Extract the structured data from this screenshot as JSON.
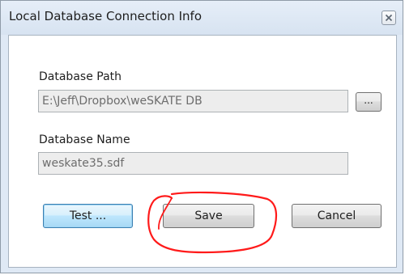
{
  "window": {
    "title": "Local Database Connection Info",
    "close_icon": "close-icon"
  },
  "form": {
    "path_label": "Database Path",
    "path_value": "E:\\Jeff\\Dropbox\\weSKATE DB",
    "browse_label": "...",
    "name_label": "Database Name",
    "name_value": "weskate35.sdf"
  },
  "buttons": {
    "test_label": "Test ...",
    "save_label": "Save",
    "cancel_label": "Cancel"
  },
  "annotation": {
    "color": "#ff1a1a",
    "target": "save-button"
  }
}
